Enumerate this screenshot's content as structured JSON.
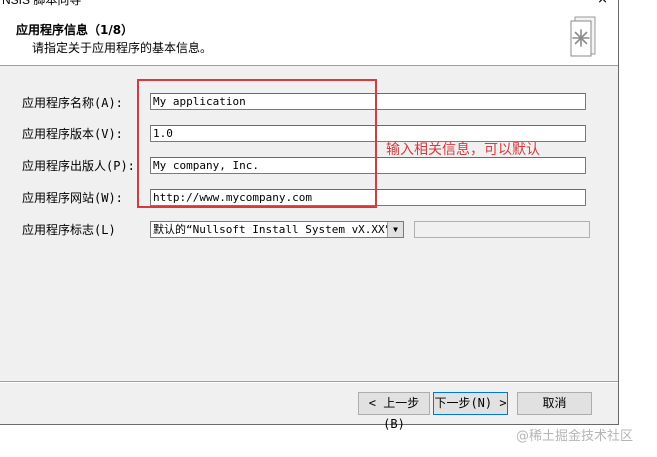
{
  "window": {
    "title": "NSIS 脚本向导",
    "close_glyph": "×"
  },
  "header": {
    "title": "应用程序信息（1/8）",
    "subtitle": "请指定关于应用程序的基本信息。"
  },
  "fields": [
    {
      "label": "应用程序名称(A):",
      "value": "My application"
    },
    {
      "label": "应用程序版本(V):",
      "value": "1.0"
    },
    {
      "label": "应用程序出版人(P):",
      "value": "My company, Inc."
    },
    {
      "label": "应用程序网站(W):",
      "value": "http://www.mycompany.com"
    }
  ],
  "brand": {
    "label": "应用程序标志(L)",
    "selected": "默认的“Nullsoft Install System vX.XX”",
    "arrow": "▼",
    "secondary_value": ""
  },
  "annotation": {
    "text": "输入相关信息，可以默认",
    "color": "#d9383c"
  },
  "buttons": {
    "back": "< 上一步(B)",
    "next": "下一步(N) >",
    "cancel": "取消"
  },
  "watermark": "@稀土掘金技术社区",
  "icons": {
    "header_icon": "document-star-icon"
  }
}
